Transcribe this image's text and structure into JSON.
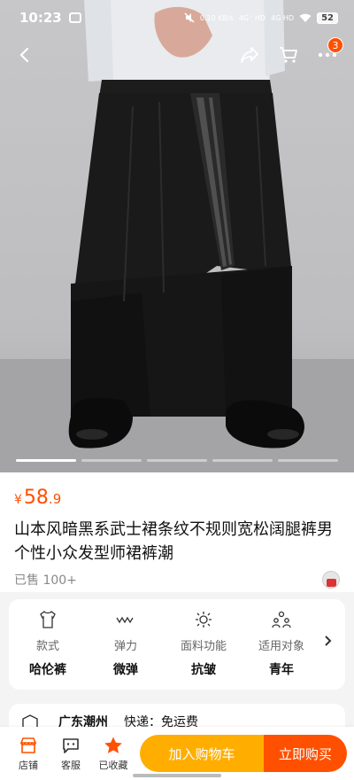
{
  "status_bar": {
    "time": "10:23",
    "speed": "0.10 KB/s",
    "net1": "4G⁺ HD",
    "net2": "4G HD",
    "battery": "52"
  },
  "nav": {
    "cart_badge": "3"
  },
  "gallery": {
    "total_slides": 5,
    "active_index": 0
  },
  "product": {
    "price_symbol": "¥",
    "price_integer": "58",
    "price_decimal": ".9",
    "title": "山本风暗黑系武士裙条纹不规则宽松阔腿裤男个性小众发型师裙裤潮",
    "sold": "已售 100+"
  },
  "attributes": [
    {
      "label": "款式",
      "value": "哈伦裤",
      "icon": "shirt-icon"
    },
    {
      "label": "弹力",
      "value": "微弹",
      "icon": "stretch-icon"
    },
    {
      "label": "面料功能",
      "value": "抗皱",
      "icon": "fabric-icon"
    },
    {
      "label": "适用对象",
      "value": "青年",
      "icon": "people-icon"
    }
  ],
  "shipping": {
    "location": "广东潮州",
    "text": "快递：免运费"
  },
  "bottom_bar": {
    "store": "店铺",
    "service": "客服",
    "favorite": "已收藏",
    "add_to_cart": "加入购物车",
    "buy_now": "立即购买"
  },
  "colors": {
    "accent": "#ff5000",
    "cart_button": "#ffae00",
    "favorite_star": "#ff5000"
  }
}
